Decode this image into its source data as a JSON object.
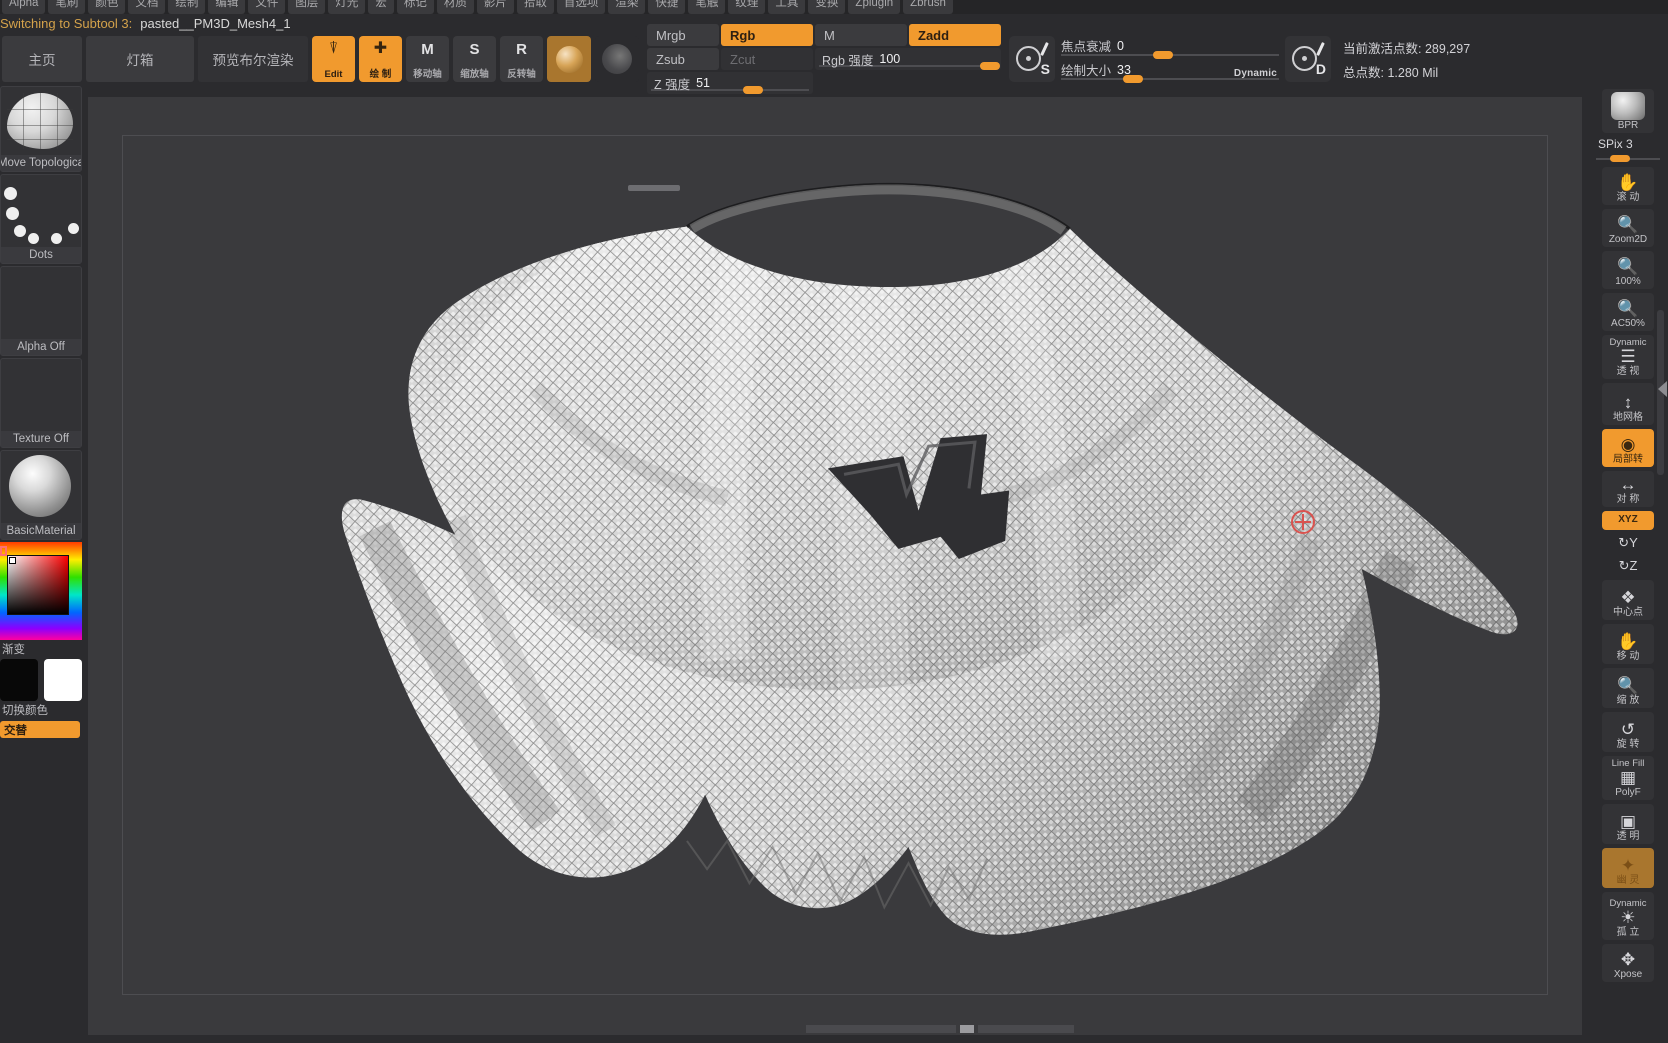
{
  "app": {
    "name": "ZBrush"
  },
  "menubar": {
    "items": [
      "Alpha",
      "笔刷",
      "颜色",
      "文档",
      "绘制",
      "编辑",
      "文件",
      "图层",
      "灯光",
      "宏",
      "标记",
      "材质",
      "影片",
      "拾取",
      "首选项",
      "渲染",
      "快捷",
      "笔触",
      "纹理",
      "工具",
      "变换",
      "Zplugin",
      "Zbrush"
    ]
  },
  "status": {
    "message": "Switching to Subtool 3:",
    "file": "pasted__PM3D_Mesh4_1"
  },
  "toolbar": {
    "home_label": "主页",
    "lightbox_label": "灯箱",
    "boolean_label": "预览布尔渲染",
    "edit_label": "Edit",
    "draw_label": "绘 制",
    "move_label": "移动轴",
    "scale_label": "缩放轴",
    "rotate_label": "反转轴",
    "move_letter": "M",
    "scale_letter": "S",
    "rotate_letter": "R",
    "drawmodes": {
      "mrgb": "Mrgb",
      "rgb": "Rgb",
      "m": "M",
      "zadd": "Zadd",
      "zsub": "Zsub",
      "zcut": "Zcut",
      "rgb_intensity_label": "Rgb 强度",
      "rgb_intensity_value": "100",
      "z_intensity_label": "Z 强度",
      "z_intensity_value": "51"
    },
    "focal_shift_label": "焦点衰减",
    "focal_shift_value": "0",
    "draw_size_label": "绘制大小",
    "draw_size_value": "33",
    "dynamic_label": "Dynamic",
    "stroke_letter": "S",
    "dyn_letter": "D",
    "active_points_label": "当前激活点数:",
    "active_points_value": "289,297",
    "total_points_label": "总点数:",
    "total_points_value": "1.280 Mil"
  },
  "left_palette": {
    "brush_caption": "Move Topologica",
    "stroke_caption": "Dots",
    "alpha_caption": "Alpha Off",
    "texture_caption": "Texture Off",
    "material_caption": "BasicMaterial",
    "gradient_caption": "渐变",
    "switch_color_caption": "切换颜色",
    "alternate_caption": "交替"
  },
  "right_sidebar": {
    "items": [
      {
        "label": "BPR",
        "top": "",
        "icon": "sphere-render-icon",
        "state": "off"
      },
      {
        "label": "SPix 3",
        "top": "",
        "icon": "spix-slider",
        "state": "slider"
      },
      {
        "label": "滚 动",
        "top": "",
        "icon": "hand-scroll-icon",
        "state": "off"
      },
      {
        "label": "Zoom2D",
        "top": "",
        "icon": "magnifier-icon",
        "state": "off"
      },
      {
        "label": "100%",
        "top": "",
        "icon": "magnifier-100-icon",
        "state": "off"
      },
      {
        "label": "AC50%",
        "top": "",
        "icon": "magnifier-ac-icon",
        "state": "off"
      },
      {
        "label": "透 视",
        "top": "Dynamic",
        "icon": "perspective-icon",
        "state": "off"
      },
      {
        "label": "地网格",
        "top": "",
        "icon": "floor-grid-icon",
        "state": "off"
      },
      {
        "label": "局部转",
        "top": "",
        "icon": "local-rotate-icon",
        "state": "on"
      },
      {
        "label": "对 称",
        "top": "",
        "icon": "symmetry-icon",
        "state": "off"
      },
      {
        "label": "XYZ",
        "top": "",
        "icon": "axis-xyz-icon",
        "state": "on"
      },
      {
        "label": "",
        "top": "",
        "icon": "rotate-y-icon",
        "state": "plain"
      },
      {
        "label": "",
        "top": "",
        "icon": "rotate-z-icon",
        "state": "plain"
      },
      {
        "label": "中心点",
        "top": "",
        "icon": "frame-center-icon",
        "state": "off"
      },
      {
        "label": "移 动",
        "top": "",
        "icon": "move-hand-icon",
        "state": "off"
      },
      {
        "label": "缩 放",
        "top": "",
        "icon": "scale-icon",
        "state": "off"
      },
      {
        "label": "旋 转",
        "top": "",
        "icon": "rotate-icon",
        "state": "off"
      },
      {
        "label": "PolyF",
        "top": "Line Fill",
        "icon": "polyframe-icon",
        "state": "off"
      },
      {
        "label": "透 明",
        "top": "",
        "icon": "transparency-icon",
        "state": "off"
      },
      {
        "label": "幽 灵",
        "top": "",
        "icon": "ghost-icon",
        "state": "brown"
      },
      {
        "label": "孤 立",
        "top": "Dynamic",
        "icon": "solo-icon",
        "state": "off"
      },
      {
        "label": "Xpose",
        "top": "",
        "icon": "xpose-icon",
        "state": "off"
      }
    ]
  },
  "colors": {
    "accent_orange": "#f19a2e",
    "status_orange": "#d4a24b",
    "panel_bg": "#2b2b2e",
    "canvas_bg": "#3a3a3d",
    "button_bg": "#3b3b3e",
    "cursor_red": "#d9534f"
  }
}
